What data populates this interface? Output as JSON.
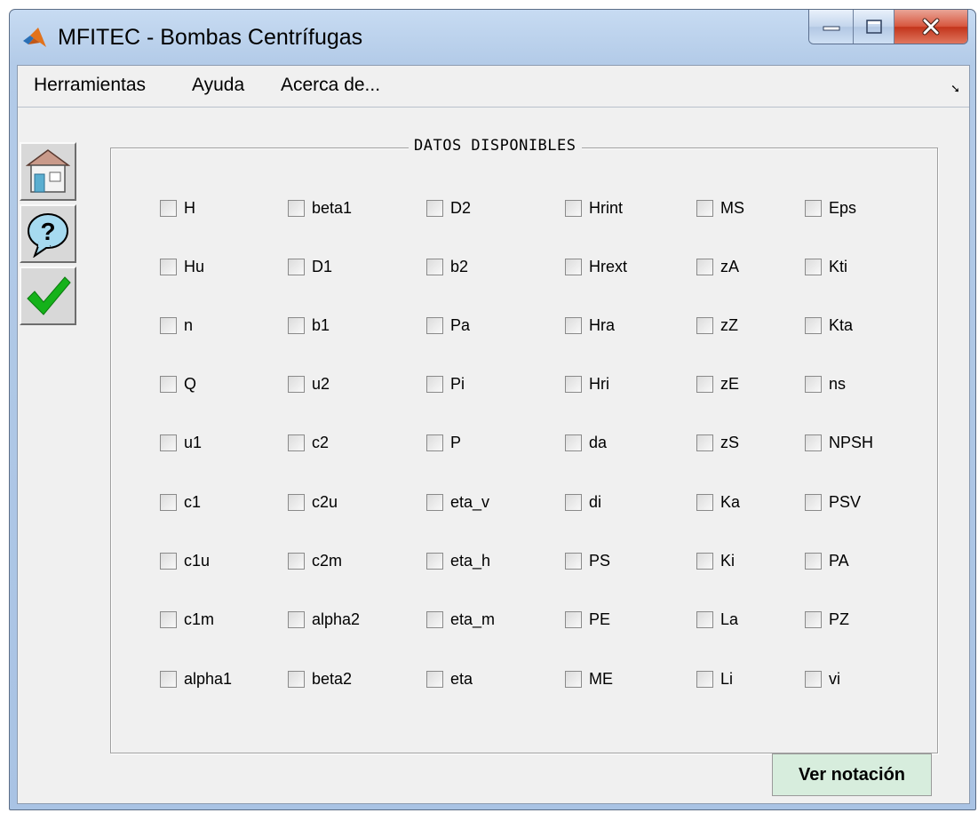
{
  "window": {
    "title": "MFITEC - Bombas Centrífugas"
  },
  "menu": {
    "items": [
      "Herramientas",
      "Ayuda",
      "Acerca de..."
    ],
    "dock_arrow": "➘"
  },
  "toolbar": {
    "buttons": [
      {
        "icon": "house-icon"
      },
      {
        "icon": "help-bubble-icon"
      },
      {
        "icon": "checkmark-icon"
      }
    ]
  },
  "panel": {
    "title": "DATOS DISPONIBLES",
    "columns": [
      [
        "H",
        "Hu",
        "n",
        "Q",
        "u1",
        "c1",
        "c1u",
        "c1m",
        "alpha1"
      ],
      [
        "beta1",
        "D1",
        "b1",
        "u2",
        "c2",
        "c2u",
        "c2m",
        "alpha2",
        "beta2"
      ],
      [
        "D2",
        "b2",
        "Pa",
        "Pi",
        "P",
        "eta_v",
        "eta_h",
        "eta_m",
        "eta"
      ],
      [
        "Hrint",
        "Hrext",
        "Hra",
        "Hri",
        "da",
        "di",
        "PS",
        "PE",
        "ME"
      ],
      [
        "MS",
        "zA",
        "zZ",
        "zE",
        "zS",
        "Ka",
        "Ki",
        "La",
        "Li"
      ],
      [
        "Eps",
        "Kti",
        "Kta",
        "ns",
        "NPSH",
        "PSV",
        "PA",
        "PZ",
        "vi"
      ]
    ]
  },
  "buttons": {
    "notation": "Ver notación"
  },
  "colors": {
    "title_bar": "#b9d1ea",
    "client_bg": "#f0f0f0",
    "close_button": "#c7432a",
    "notation_button_bg": "#d7eddd"
  }
}
